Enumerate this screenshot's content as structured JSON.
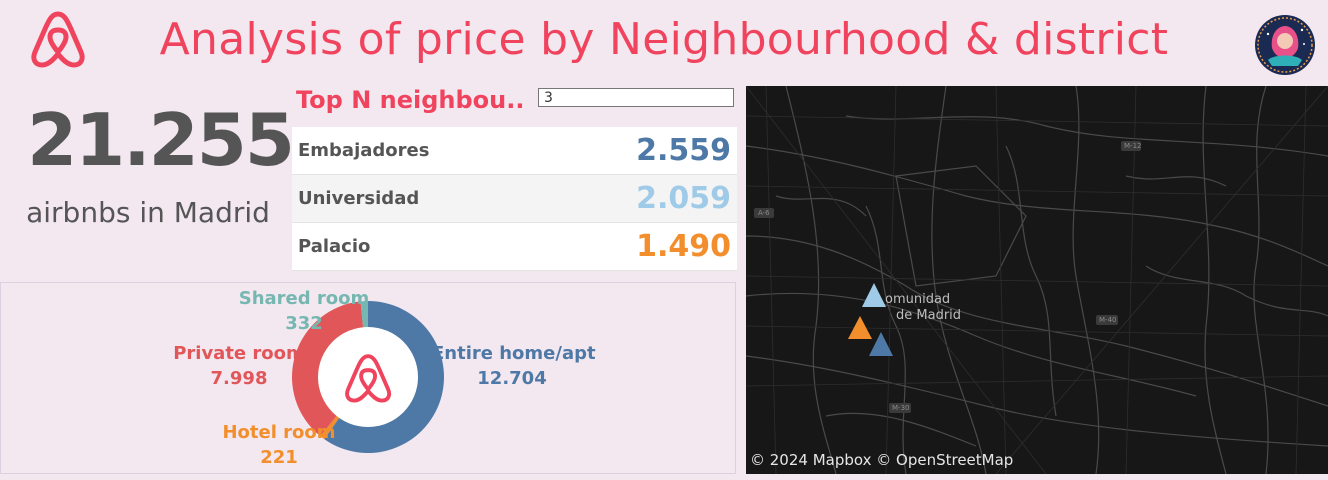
{
  "header": {
    "title": "Analysis of price by Neighbourhood & district",
    "logo_icon": "airbnb-logo-icon",
    "avatar_icon": "profile-avatar-icon"
  },
  "kpi": {
    "value": "21.255",
    "label": "airbnbs in Madrid"
  },
  "top_n": {
    "label": "Top N neighbou..",
    "input_value": "3",
    "rows": [
      {
        "name": "Embajadores",
        "value": "2.559",
        "color": "#4e79a7"
      },
      {
        "name": "Universidad",
        "value": "2.059",
        "color": "#a0cbe8"
      },
      {
        "name": "Palacio",
        "value": "1.490",
        "color": "#f28e2b"
      }
    ]
  },
  "chart_data": {
    "type": "pie",
    "donut": true,
    "categories": [
      "Entire home/apt",
      "Hotel room",
      "Private room",
      "Shared room"
    ],
    "values": [
      12704,
      221,
      7998,
      332
    ],
    "value_labels": [
      "12.704",
      "221",
      "7.998",
      "332"
    ],
    "colors": [
      "#4e79a7",
      "#f28e2b",
      "#e15759",
      "#76b7b2"
    ],
    "center_icon": "airbnb-logo-icon"
  },
  "map": {
    "place_label": "Comunidad de Madrid",
    "place_label_line1": "omunidad",
    "place_label_line2": "de Madrid",
    "roads": [
      "A-6",
      "M-12",
      "M-40",
      "M-30"
    ],
    "credit": "© 2024 Mapbox © OpenStreetMap",
    "markers": [
      {
        "name": "Universidad",
        "color": "#a0cbe8"
      },
      {
        "name": "Palacio",
        "color": "#f28e2b"
      },
      {
        "name": "Embajadores",
        "color": "#4e79a7"
      }
    ]
  }
}
